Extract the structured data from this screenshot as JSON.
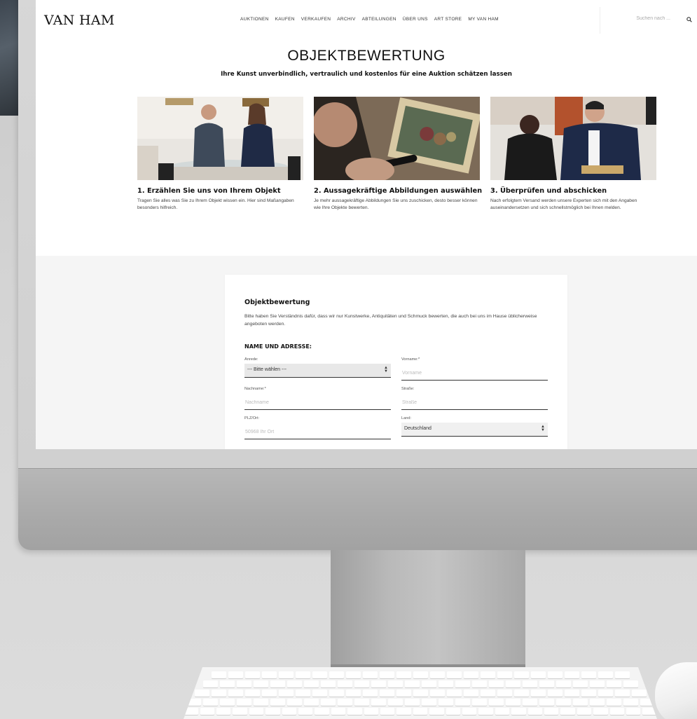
{
  "header": {
    "logo": "VAN HAM",
    "nav_items": [
      "AUKTIONEN",
      "KAUFEN",
      "VERKAUFEN",
      "ARCHIV",
      "ABTEILUNGEN",
      "ÜBER UNS",
      "ART STORE",
      "MY VAN HAM"
    ],
    "search_placeholder": "Suchen nach ..."
  },
  "hero": {
    "title": "OBJEKTBEWERTUNG",
    "subtitle": "Ihre Kunst unverbindlich, vertraulich und kostenlos für eine Auktion schätzen lassen"
  },
  "steps": [
    {
      "title": "1. Erzählen Sie uns von Ihrem Objekt",
      "text": "Tragen Sie alles was Sie zu Ihrem Objekt wissen ein. Hier sind Maßangaben besonders hilfreich."
    },
    {
      "title": "2. Aussagekräftige Abbildungen auswählen",
      "text": "Je mehr aussagekräftige Abbildungen Sie uns zuschicken, desto besser können wie Ihre Objekte bewerten."
    },
    {
      "title": "3. Überprüfen und abschicken",
      "text": "Nach erfolgtem Versand werden unsere Experten sich mit den Angaben auseinandersetzen und sich schnellstmöglich bei Ihnen melden."
    }
  ],
  "form": {
    "title": "Objektbewertung",
    "intro": "Bitte haben Sie Verständnis dafür, dass wir nur Kunstwerke, Antiquitäten und Schmuck bewerten, die auch bei uns im Hause üblicherweise angeboten werden.",
    "section_heading": "NAME UND ADRESSE:",
    "fields": {
      "anrede": {
        "label": "Anrede:",
        "value": "--- Bitte wählen ---"
      },
      "vorname": {
        "label": "Vorname:*",
        "placeholder": "Vorname"
      },
      "nachname": {
        "label": "Nachname:*",
        "placeholder": "Nachname"
      },
      "strasse": {
        "label": "Straße:",
        "placeholder": "Straße"
      },
      "plz_ort": {
        "label": "PLZ/Ort:",
        "placeholder": "50968 Ihr Ort"
      },
      "land": {
        "label": "Land:",
        "value": "Deutschland"
      }
    }
  },
  "colors": {
    "screen_bg": "#ffffff",
    "band_bg": "#f5f5f5",
    "text": "#111111",
    "select_bg": "#e8e8e8",
    "monitor_silver": "#cfcfcf"
  }
}
